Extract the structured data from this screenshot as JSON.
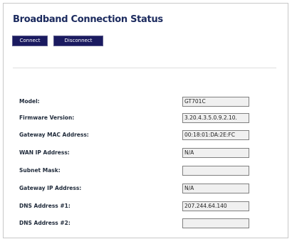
{
  "page": {
    "title": "Broadband Connection Status",
    "buttons": {
      "connect": "Connect",
      "disconnect": "Disconnect"
    }
  },
  "status": {
    "model_label": "Model:",
    "model_value": "GT701C",
    "firmware_label": "Firmware Version:",
    "firmware_value": "3.20.4.3.5.0.9.2.10.",
    "gateway_mac_label": "Gateway MAC Address:",
    "gateway_mac_value": "00:18:01:DA:2E:FC",
    "wan_ip_label": "WAN IP Address:",
    "wan_ip_value": "N/A",
    "subnet_label": "Subnet Mask:",
    "subnet_value": "",
    "gateway_ip_label": "Gateway IP Address:",
    "gateway_ip_value": "N/A",
    "dns1_label": "DNS Address #1:",
    "dns1_value": "207.244.64.140",
    "dns2_label": "DNS Address #2:",
    "dns2_value": ""
  },
  "colors": {
    "title": "#1b2a5e",
    "button_bg": "#1a1a60",
    "field_bg": "#f0f0f0"
  }
}
